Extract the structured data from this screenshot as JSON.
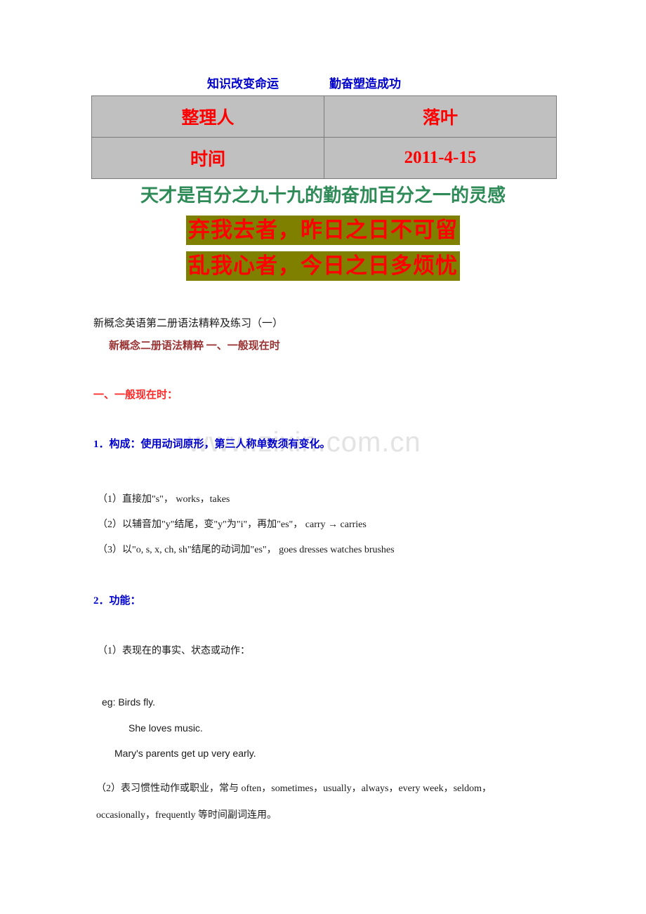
{
  "header": {
    "motto_left": "知识改变命运",
    "motto_right": "勤奋塑造成功",
    "motto_color": "#0000cc"
  },
  "info_table": {
    "rows": [
      {
        "label": "整理人",
        "value": "落叶"
      },
      {
        "label": "时间",
        "value": "2011-4-15"
      }
    ],
    "cell_background": "#c0c0c0",
    "text_color": "#ff0000",
    "border_color": "#7a7a7a"
  },
  "quotes": {
    "green_line": "天才是百分之九十九的勤奋加百分之一的灵感",
    "green_color": "#2e8b57",
    "couplet": [
      "弃我去者，昨日之日不可留",
      "乱我心者，今日之日多烦忧"
    ],
    "couplet_highlight": "#808000",
    "couplet_text_color": "#ff0000"
  },
  "watermark": {
    "text": "www.zixin.com.cn",
    "color": "#e3e3e3"
  },
  "document": {
    "title": "新概念英语第二册语法精粹及练习（一）",
    "subtitle": "新概念二册语法精粹  一、一般现在时",
    "subtitle_color": "#993333",
    "section_heading": "一、一般现在时：",
    "section_heading_color": "#ff2a2a",
    "sub_headings": {
      "construct": "1．构成：使用动词原形，第三人称单数须有变化。",
      "function": "2．功能：",
      "color": "#0000cc"
    },
    "construct_rules": [
      "（1）直接加\"s\"，  works，takes",
      "（2）以辅音加\"y\"结尾，变\"y\"为\"i\"，再加\"es\"， carry → carries",
      "（3）以\"o, s, x, ch, sh\"结尾的动词加\"es\"，  goes   dresses   watches    brushes"
    ],
    "function_items": [
      "（1）表现在的事实、状态或动作："
    ],
    "examples": [
      "eg: Birds fly.",
      "She loves music.",
      "Mary's parents get up very early."
    ],
    "function_item_2": [
      "（2）表习惯性动作或职业，常与 often，sometimes，usually，always，every week，seldom，",
      "occasionally，frequently 等时间副词连用。"
    ]
  }
}
